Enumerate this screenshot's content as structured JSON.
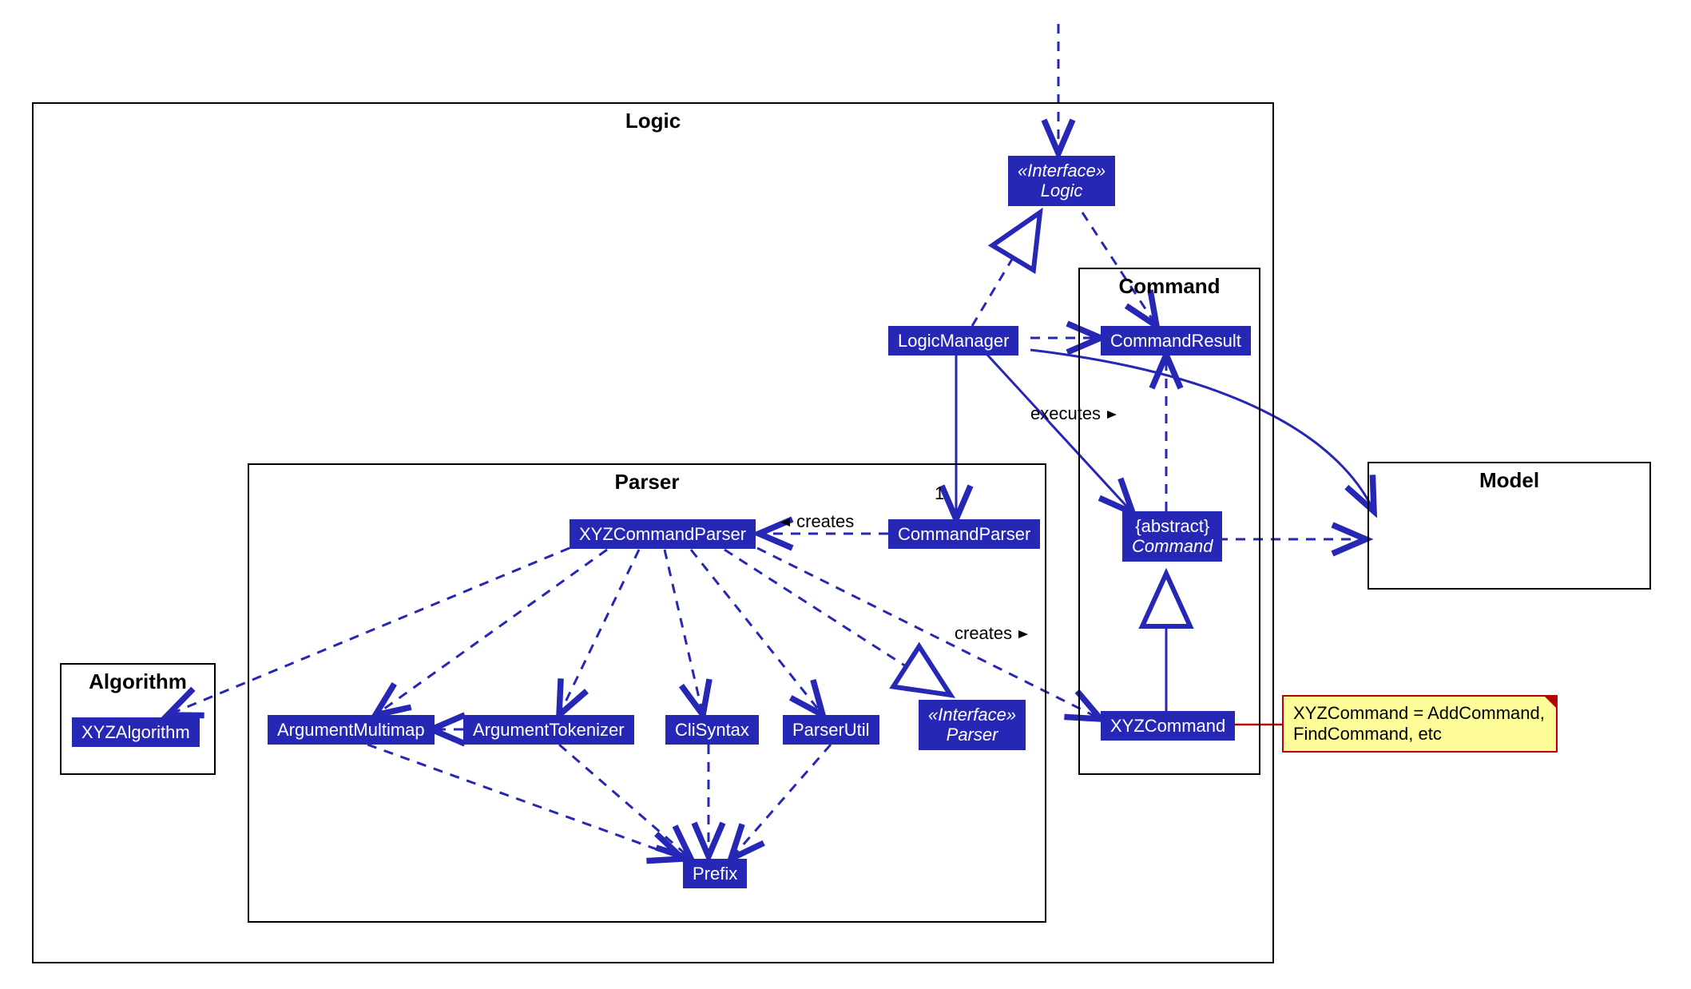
{
  "packages": {
    "logic": {
      "title": "Logic"
    },
    "parser": {
      "title": "Parser"
    },
    "command": {
      "title": "Command"
    },
    "algorithm": {
      "title": "Algorithm"
    },
    "model": {
      "title": "Model"
    }
  },
  "nodes": {
    "logic_iface": {
      "stereotype": "«Interface»",
      "name": "Logic"
    },
    "logic_manager": {
      "name": "LogicManager"
    },
    "command_result": {
      "name": "CommandResult"
    },
    "abstract_command": {
      "stereotype": "{abstract}",
      "name": "Command"
    },
    "xyz_command": {
      "name": "XYZCommand"
    },
    "command_parser": {
      "name": "CommandParser"
    },
    "xyz_cmd_parser": {
      "name": "XYZCommandParser"
    },
    "xyz_algorithm": {
      "name": "XYZAlgorithm"
    },
    "arg_multimap": {
      "name": "ArgumentMultimap"
    },
    "arg_tokenizer": {
      "name": "ArgumentTokenizer"
    },
    "cli_syntax": {
      "name": "CliSyntax"
    },
    "parser_util": {
      "name": "ParserUtil"
    },
    "parser_iface": {
      "stereotype": "«Interface»",
      "name": "Parser"
    },
    "prefix": {
      "name": "Prefix"
    }
  },
  "note": {
    "text1": "XYZCommand = AddCommand,",
    "text2": "FindCommand, etc"
  },
  "edge_labels": {
    "creates1": "creates",
    "creates2": "creates",
    "executes": "executes",
    "mult_one": "1"
  }
}
